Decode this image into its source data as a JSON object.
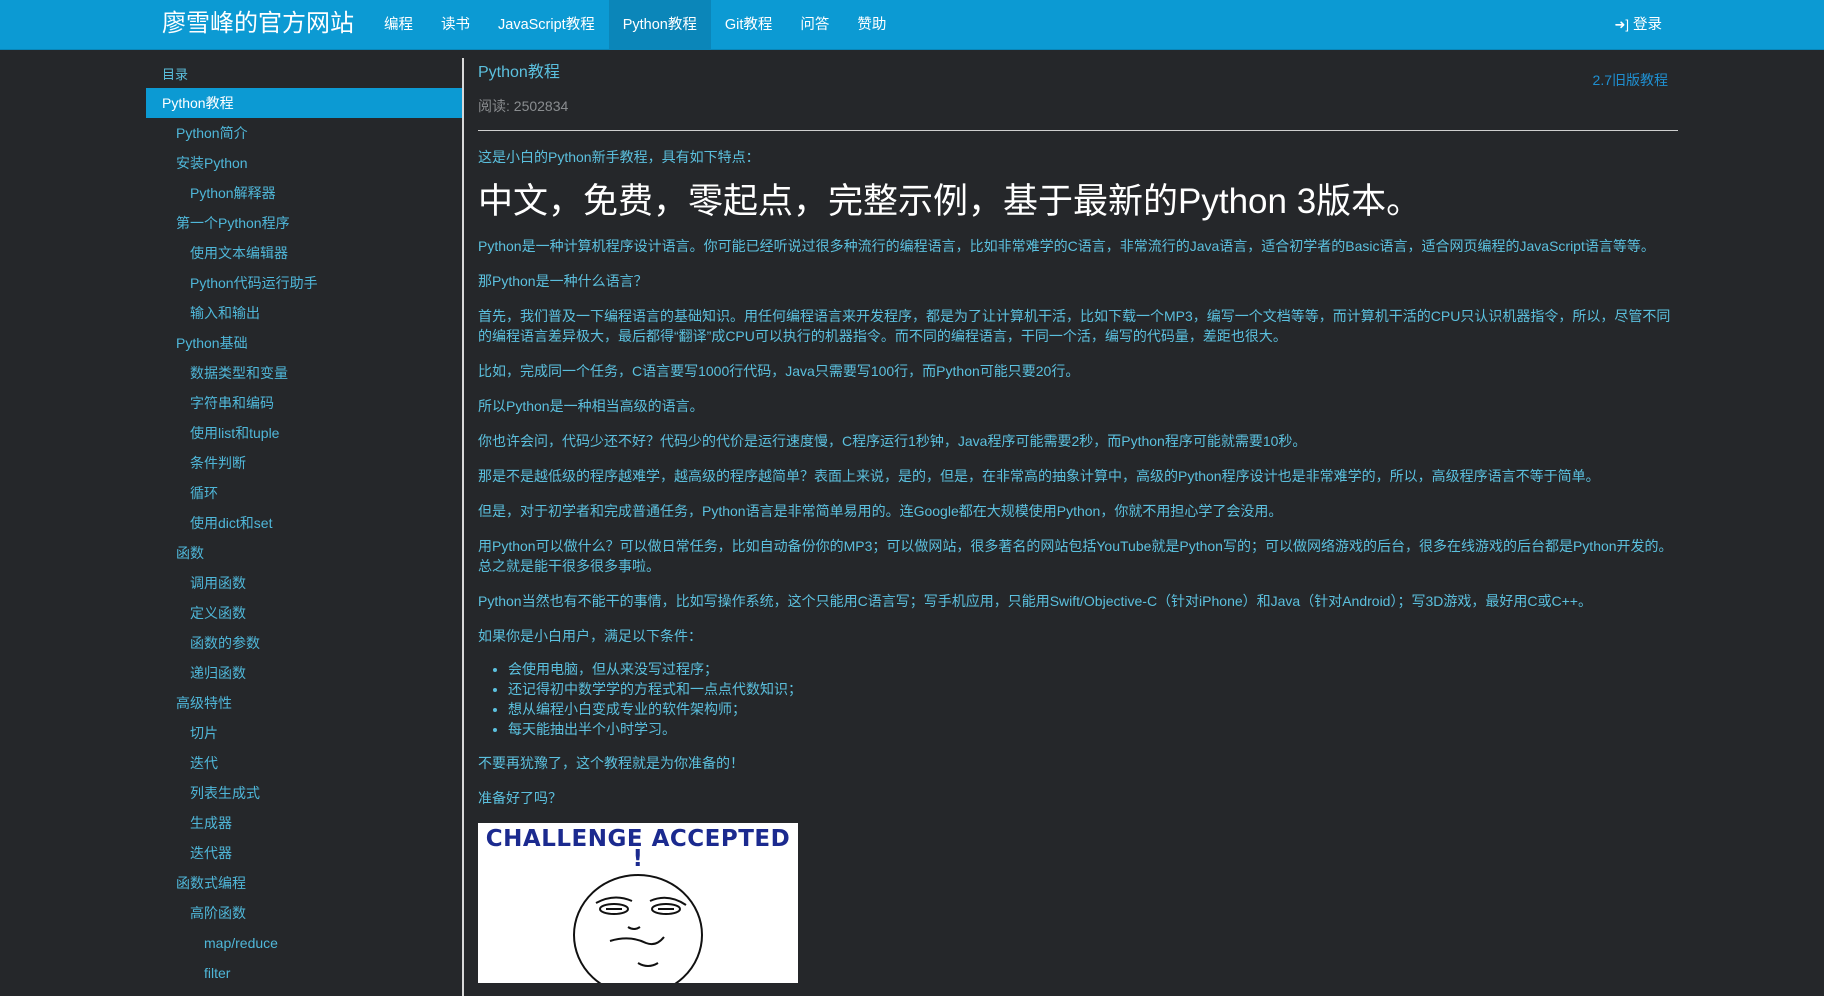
{
  "header": {
    "brand": "廖雪峰的官方网站",
    "nav": [
      {
        "label": "编程",
        "active": false
      },
      {
        "label": "读书",
        "active": false
      },
      {
        "label": "JavaScript教程",
        "active": false
      },
      {
        "label": "Python教程",
        "active": true
      },
      {
        "label": "Git教程",
        "active": false
      },
      {
        "label": "问答",
        "active": false
      },
      {
        "label": "赞助",
        "active": false
      }
    ],
    "login_icon": "sign-in-icon",
    "login_label": "登录"
  },
  "sidebar": {
    "title": "目录",
    "items": [
      {
        "label": "Python教程",
        "level": 0,
        "active": true
      },
      {
        "label": "Python简介",
        "level": 1
      },
      {
        "label": "安装Python",
        "level": 1
      },
      {
        "label": "Python解释器",
        "level": 2
      },
      {
        "label": "第一个Python程序",
        "level": 1
      },
      {
        "label": "使用文本编辑器",
        "level": 2
      },
      {
        "label": "Python代码运行助手",
        "level": 2
      },
      {
        "label": "输入和输出",
        "level": 2
      },
      {
        "label": "Python基础",
        "level": 1
      },
      {
        "label": "数据类型和变量",
        "level": 2
      },
      {
        "label": "字符串和编码",
        "level": 2
      },
      {
        "label": "使用list和tuple",
        "level": 2
      },
      {
        "label": "条件判断",
        "level": 2
      },
      {
        "label": "循环",
        "level": 2
      },
      {
        "label": "使用dict和set",
        "level": 2
      },
      {
        "label": "函数",
        "level": 1
      },
      {
        "label": "调用函数",
        "level": 2
      },
      {
        "label": "定义函数",
        "level": 2
      },
      {
        "label": "函数的参数",
        "level": 2
      },
      {
        "label": "递归函数",
        "level": 2
      },
      {
        "label": "高级特性",
        "level": 1
      },
      {
        "label": "切片",
        "level": 2
      },
      {
        "label": "迭代",
        "level": 2
      },
      {
        "label": "列表生成式",
        "level": 2
      },
      {
        "label": "生成器",
        "level": 2
      },
      {
        "label": "迭代器",
        "level": 2
      },
      {
        "label": "函数式编程",
        "level": 1
      },
      {
        "label": "高阶函数",
        "level": 2
      },
      {
        "label": "map/reduce",
        "level": 3
      },
      {
        "label": "filter",
        "level": 3
      }
    ]
  },
  "main": {
    "title": "Python教程",
    "legacy_link": "2.7旧版教程",
    "read_count": "阅读: 2502834",
    "intro": "这是小白的Python新手教程，具有如下特点：",
    "headline": "中文，免费，零起点，完整示例，基于最新的Python 3版本。",
    "paragraphs_a": [
      "Python是一种计算机程序设计语言。你可能已经听说过很多种流行的编程语言，比如非常难学的C语言，非常流行的Java语言，适合初学者的Basic语言，适合网页编程的JavaScript语言等等。",
      "那Python是一种什么语言？",
      "首先，我们普及一下编程语言的基础知识。用任何编程语言来开发程序，都是为了让计算机干活，比如下载一个MP3，编写一个文档等等，而计算机干活的CPU只认识机器指令，所以，尽管不同的编程语言差异极大，最后都得“翻译”成CPU可以执行的机器指令。而不同的编程语言，干同一个活，编写的代码量，差距也很大。",
      "比如，完成同一个任务，C语言要写1000行代码，Java只需要写100行，而Python可能只要20行。",
      "所以Python是一种相当高级的语言。",
      "你也许会问，代码少还不好？代码少的代价是运行速度慢，C程序运行1秒钟，Java程序可能需要2秒，而Python程序可能就需要10秒。",
      "那是不是越低级的程序越难学，越高级的程序越简单？表面上来说，是的，但是，在非常高的抽象计算中，高级的Python程序设计也是非常难学的，所以，高级程序语言不等于简单。",
      "但是，对于初学者和完成普通任务，Python语言是非常简单易用的。连Google都在大规模使用Python，你就不用担心学了会没用。",
      "用Python可以做什么？可以做日常任务，比如自动备份你的MP3；可以做网站，很多著名的网站包括YouTube就是Python写的；可以做网络游戏的后台，很多在线游戏的后台都是Python开发的。总之就是能干很多很多事啦。",
      "Python当然也有不能干的事情，比如写操作系统，这个只能用C语言写；写手机应用，只能用Swift/Objective-C（针对iPhone）和Java（针对Android）；写3D游戏，最好用C或C++。",
      "如果你是小白用户，满足以下条件："
    ],
    "bullets": [
      "会使用电脑，但从来没写过程序；",
      "还记得初中数学学的方程式和一点点代数知识；",
      "想从编程小白变成专业的软件架构师；",
      "每天能抽出半个小时学习。"
    ],
    "paragraphs_b": [
      "不要再犹豫了，这个教程就是为你准备的！",
      "准备好了吗？"
    ],
    "meme_caption": "CHALLENGE ACCEPTED !"
  }
}
